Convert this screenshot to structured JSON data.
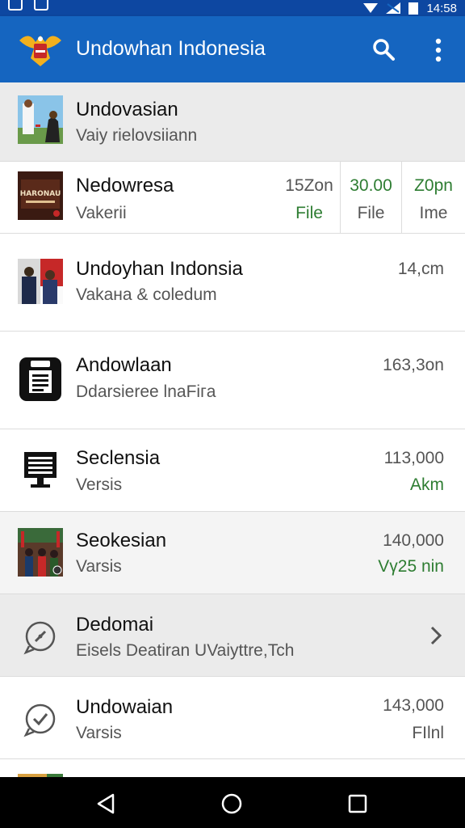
{
  "status_bar": {
    "time": "14:58"
  },
  "app_bar": {
    "title": "Undowhan Indonesia",
    "search_icon": "search-icon",
    "more_icon": "more-vert-icon",
    "brand_color": "#1565c0"
  },
  "rows": [
    {
      "name": "Undovasian",
      "sub": "Vaiy rielovsiiann"
    },
    {
      "name": "Nedowresa",
      "sub": "Vakerii",
      "cols": [
        {
          "top": "15Zon",
          "bottom": "File"
        },
        {
          "top": "30.00",
          "bottom": "File"
        },
        {
          "top": "Z0pn",
          "bottom": "Ime"
        }
      ]
    },
    {
      "name": "Undoyhan Indonsia",
      "sub": "Vakaнa & coledum",
      "value": "14,cm"
    },
    {
      "name": "Andowlaan",
      "sub": "Ddarsieree lnaFiгa",
      "value": "163,3on"
    },
    {
      "name": "Seclensia",
      "sub": "Versis",
      "value": "113,000",
      "value2": "Akm"
    },
    {
      "name": "Seokesian",
      "sub": "Varsis",
      "value": "140,000",
      "value2": "Vγ25 nin"
    },
    {
      "name": "Dedomai",
      "sub": "Eisels Deatiran UVaiyttre,Tch"
    },
    {
      "name": "Undowaian",
      "sub": "Varsis",
      "value": "143,000",
      "value2": "FIlnl"
    }
  ],
  "colors": {
    "green": "#2e7d32",
    "divider": "#dcdcdc"
  }
}
